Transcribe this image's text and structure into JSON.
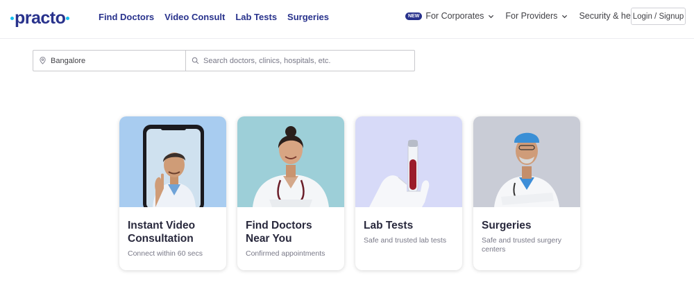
{
  "brand": {
    "logo_text": "practo",
    "accent": "#14bef0",
    "primary": "#28328c"
  },
  "nav": {
    "main": [
      "Find Doctors",
      "Video Consult",
      "Lab Tests",
      "Surgeries"
    ],
    "corporates_badge": "NEW",
    "corporates": "For Corporates",
    "providers": "For Providers",
    "security": "Security & help",
    "login": "Login / Signup"
  },
  "search": {
    "location_value": "Bangalore",
    "query_placeholder": "Search doctors, clinics, hospitals, etc."
  },
  "cards": [
    {
      "title": "Instant Video Consultation",
      "subtitle": "Connect within 60 secs",
      "bg": "#a8ccf0"
    },
    {
      "title": "Find Doctors Near You",
      "subtitle": "Confirmed appointments",
      "bg": "#9dcfd8"
    },
    {
      "title": "Lab Tests",
      "subtitle": "Safe and trusted lab tests",
      "bg": "#d7daf8"
    },
    {
      "title": "Surgeries",
      "subtitle": "Safe and trusted surgery centers",
      "bg": "#c9ccd6"
    }
  ]
}
